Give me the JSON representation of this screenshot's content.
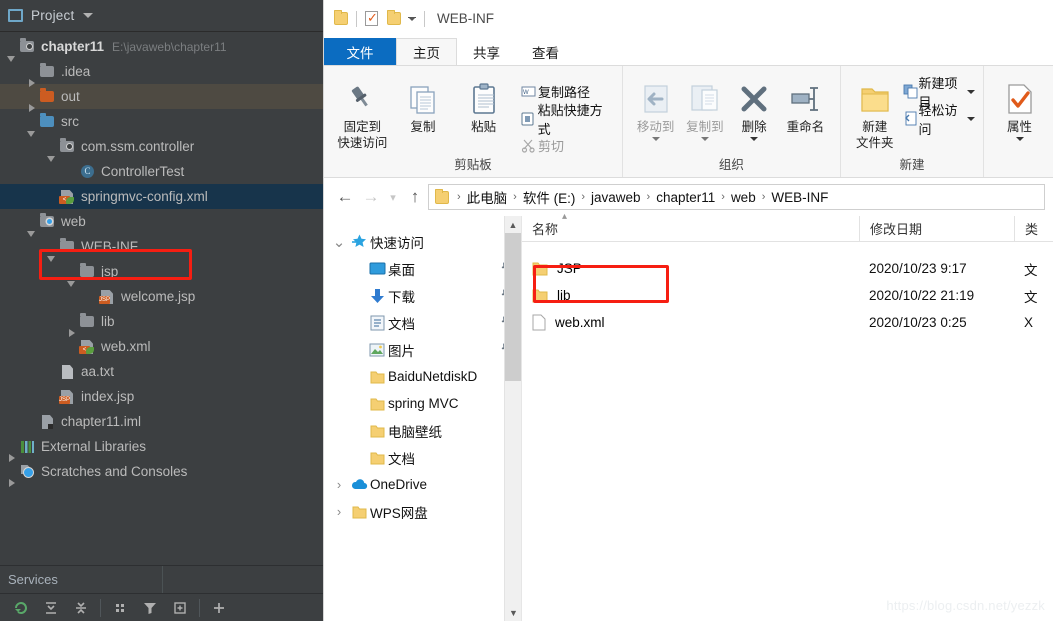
{
  "ide": {
    "toolbar": {
      "label": "Project",
      "icon": "project-icon",
      "caret": "chevron-down-icon"
    },
    "tree": [
      {
        "indent": 0,
        "twisty": "open",
        "icon": "module-folder-icon",
        "label": "chapter11",
        "bold": true,
        "path": "E:\\javaweb\\chapter11",
        "state": "normal"
      },
      {
        "indent": 1,
        "twisty": "closed",
        "icon": "folder-grey-icon",
        "label": ".idea",
        "state": "normal"
      },
      {
        "indent": 1,
        "twisty": "closed",
        "icon": "folder-orange-icon",
        "label": "out",
        "state": "hover"
      },
      {
        "indent": 1,
        "twisty": "open",
        "icon": "folder-blue-icon",
        "label": "src",
        "state": "normal"
      },
      {
        "indent": 2,
        "twisty": "open",
        "icon": "package-icon",
        "label": "com.ssm.controller",
        "state": "normal"
      },
      {
        "indent": 3,
        "twisty": "none",
        "icon": "java-class-icon",
        "label": "ControllerTest",
        "state": "normal"
      },
      {
        "indent": 2,
        "twisty": "none",
        "icon": "xml-spring-icon",
        "label": "springmvc-config.xml",
        "state": "selected"
      },
      {
        "indent": 1,
        "twisty": "open",
        "icon": "web-folder-icon",
        "label": "web",
        "state": "normal"
      },
      {
        "indent": 2,
        "twisty": "open",
        "icon": "folder-grey-icon",
        "label": "WEB-INF",
        "state": "normal"
      },
      {
        "indent": 3,
        "twisty": "open",
        "icon": "folder-grey-icon",
        "label": "jsp",
        "state": "normal"
      },
      {
        "indent": 4,
        "twisty": "none",
        "icon": "jsp-file-icon",
        "label": "welcome.jsp",
        "state": "normal"
      },
      {
        "indent": 3,
        "twisty": "closed",
        "icon": "folder-grey-icon",
        "label": "lib",
        "state": "normal"
      },
      {
        "indent": 3,
        "twisty": "none",
        "icon": "xml-web-icon",
        "label": "web.xml",
        "state": "normal"
      },
      {
        "indent": 2,
        "twisty": "none",
        "icon": "text-file-icon",
        "label": "aa.txt",
        "state": "normal"
      },
      {
        "indent": 2,
        "twisty": "none",
        "icon": "jsp-file-icon",
        "label": "index.jsp",
        "state": "normal"
      },
      {
        "indent": 1,
        "twisty": "none",
        "icon": "iml-file-icon",
        "label": "chapter11.iml",
        "state": "normal"
      },
      {
        "indent": 0,
        "twisty": "closed",
        "icon": "external-libraries-icon",
        "label": "External Libraries",
        "state": "normal"
      },
      {
        "indent": 0,
        "twisty": "closed",
        "icon": "scratches-icon",
        "label": "Scratches and Consoles",
        "state": "normal"
      }
    ],
    "services_label": "Services",
    "bottom_icons": [
      "rerun-icon",
      "expand-all-icon",
      "collapse-all-icon",
      "group-by-icon",
      "filter-icon",
      "add-tab-icon",
      "plus-icon"
    ]
  },
  "explorer": {
    "titlebar": {
      "icons": [
        "folder-icon",
        "properties-icon",
        "new-folder-icon",
        "customize-qat-caret-icon"
      ],
      "title": "WEB-INF"
    },
    "tabs": [
      {
        "label": "文件",
        "name": "tab-file",
        "style": "file"
      },
      {
        "label": "主页",
        "name": "tab-home",
        "style": "active"
      },
      {
        "label": "共享",
        "name": "tab-share",
        "style": "normal"
      },
      {
        "label": "查看",
        "name": "tab-view",
        "style": "normal"
      }
    ],
    "ribbon": {
      "groups": [
        {
          "title": "剪贴板",
          "big": [
            {
              "label_line1": "固定到",
              "label_line2": "快速访问",
              "icon": "pin-icon",
              "dim": false
            },
            {
              "label_line1": "复制",
              "label_line2": "",
              "icon": "copy-icon",
              "dim": false
            },
            {
              "label_line1": "粘贴",
              "label_line2": "",
              "icon": "paste-icon",
              "dim": false
            }
          ],
          "small": [
            {
              "label": "复制路径",
              "icon": "copy-path-icon",
              "dim": false
            },
            {
              "label": "粘贴快捷方式",
              "icon": "paste-shortcut-icon",
              "dim": false
            },
            {
              "label": "剪切",
              "icon": "cut-icon",
              "dim": true
            }
          ]
        },
        {
          "title": "组织",
          "big": [
            {
              "label_line1": "移动到",
              "label_line2": "",
              "icon": "move-to-icon",
              "dim": true,
              "caret": true
            },
            {
              "label_line1": "复制到",
              "label_line2": "",
              "icon": "copy-to-icon",
              "dim": true,
              "caret": true
            },
            {
              "label_line1": "删除",
              "label_line2": "",
              "icon": "delete-icon",
              "dim": false,
              "caret": true
            },
            {
              "label_line1": "重命名",
              "label_line2": "",
              "icon": "rename-icon",
              "dim": false
            }
          ],
          "small": []
        },
        {
          "title": "新建",
          "big": [
            {
              "label_line1": "新建",
              "label_line2": "文件夹",
              "icon": "new-folder-icon",
              "dim": false
            }
          ],
          "small": [
            {
              "label": "新建项目",
              "icon": "new-item-icon",
              "dim": false,
              "caret": true
            },
            {
              "label": "轻松访问",
              "icon": "easy-access-icon",
              "dim": false,
              "caret": true
            }
          ]
        },
        {
          "title": "",
          "big": [
            {
              "label_line1": "属性",
              "label_line2": "",
              "icon": "properties-icon",
              "dim": false,
              "caret": true
            }
          ],
          "small": []
        }
      ]
    },
    "address": {
      "back": "back-arrow-icon",
      "forward": "forward-arrow-icon",
      "recent": "recent-locations-icon",
      "up": "up-arrow-icon",
      "crumbs": [
        "此电脑",
        "软件 (E:)",
        "javaweb",
        "chapter11",
        "web",
        "WEB-INF"
      ]
    },
    "navpane": {
      "items": [
        {
          "label": "快速访问",
          "icon": "quick-access-star-icon",
          "chevron": "expanded",
          "indent": 0,
          "pinned": false
        },
        {
          "label": "桌面",
          "icon": "desktop-icon",
          "chevron": "none",
          "indent": 1,
          "pinned": true
        },
        {
          "label": "下载",
          "icon": "downloads-icon",
          "chevron": "none",
          "indent": 1,
          "pinned": true
        },
        {
          "label": "文档",
          "icon": "documents-icon",
          "chevron": "none",
          "indent": 1,
          "pinned": true
        },
        {
          "label": "图片",
          "icon": "pictures-icon",
          "chevron": "none",
          "indent": 1,
          "pinned": true
        },
        {
          "label": "BaiduNetdiskD",
          "icon": "folder-icon",
          "chevron": "none",
          "indent": 1,
          "pinned": false
        },
        {
          "label": "spring MVC",
          "icon": "folder-icon",
          "chevron": "none",
          "indent": 1,
          "pinned": false
        },
        {
          "label": "电脑壁纸",
          "icon": "folder-icon",
          "chevron": "none",
          "indent": 1,
          "pinned": false
        },
        {
          "label": "文档",
          "icon": "folder-icon",
          "chevron": "none",
          "indent": 1,
          "pinned": false
        },
        {
          "label": "OneDrive",
          "icon": "onedrive-cloud-icon",
          "chevron": "collapsed",
          "indent": 0,
          "pinned": false
        },
        {
          "label": "WPS网盘",
          "icon": "folder-icon",
          "chevron": "collapsed",
          "indent": 0,
          "pinned": false
        }
      ],
      "scrollbar": {
        "up": "scroll-up-icon",
        "down": "scroll-down-icon"
      }
    },
    "filelist": {
      "columns": [
        {
          "label": "名称",
          "sorted": true
        },
        {
          "label": "修改日期"
        },
        {
          "label": "类"
        }
      ],
      "rows": [
        {
          "name": "JSP",
          "icon": "folder-icon",
          "date": "2020/10/23 9:17",
          "type": "文"
        },
        {
          "name": "lib",
          "icon": "folder-icon",
          "date": "2020/10/22 21:19",
          "type": "文"
        },
        {
          "name": "web.xml",
          "icon": "file-icon",
          "date": "2020/10/23 0:25",
          "type": "X"
        }
      ]
    }
  },
  "annotations": {
    "redbox_tree": "jsp-folder-highlight",
    "redbox_file": "jsp-row-highlight"
  },
  "watermark": "https://blog.csdn.net/yezzk",
  "colors": {
    "ide_bg": "#3c3f41",
    "ide_selected_row": "#17344b",
    "ide_hover_row": "#4e4a42",
    "tab_accent": "#0b6cc1",
    "annotation_red": "#f61e12",
    "folder_yellow": "#f5cf72"
  }
}
